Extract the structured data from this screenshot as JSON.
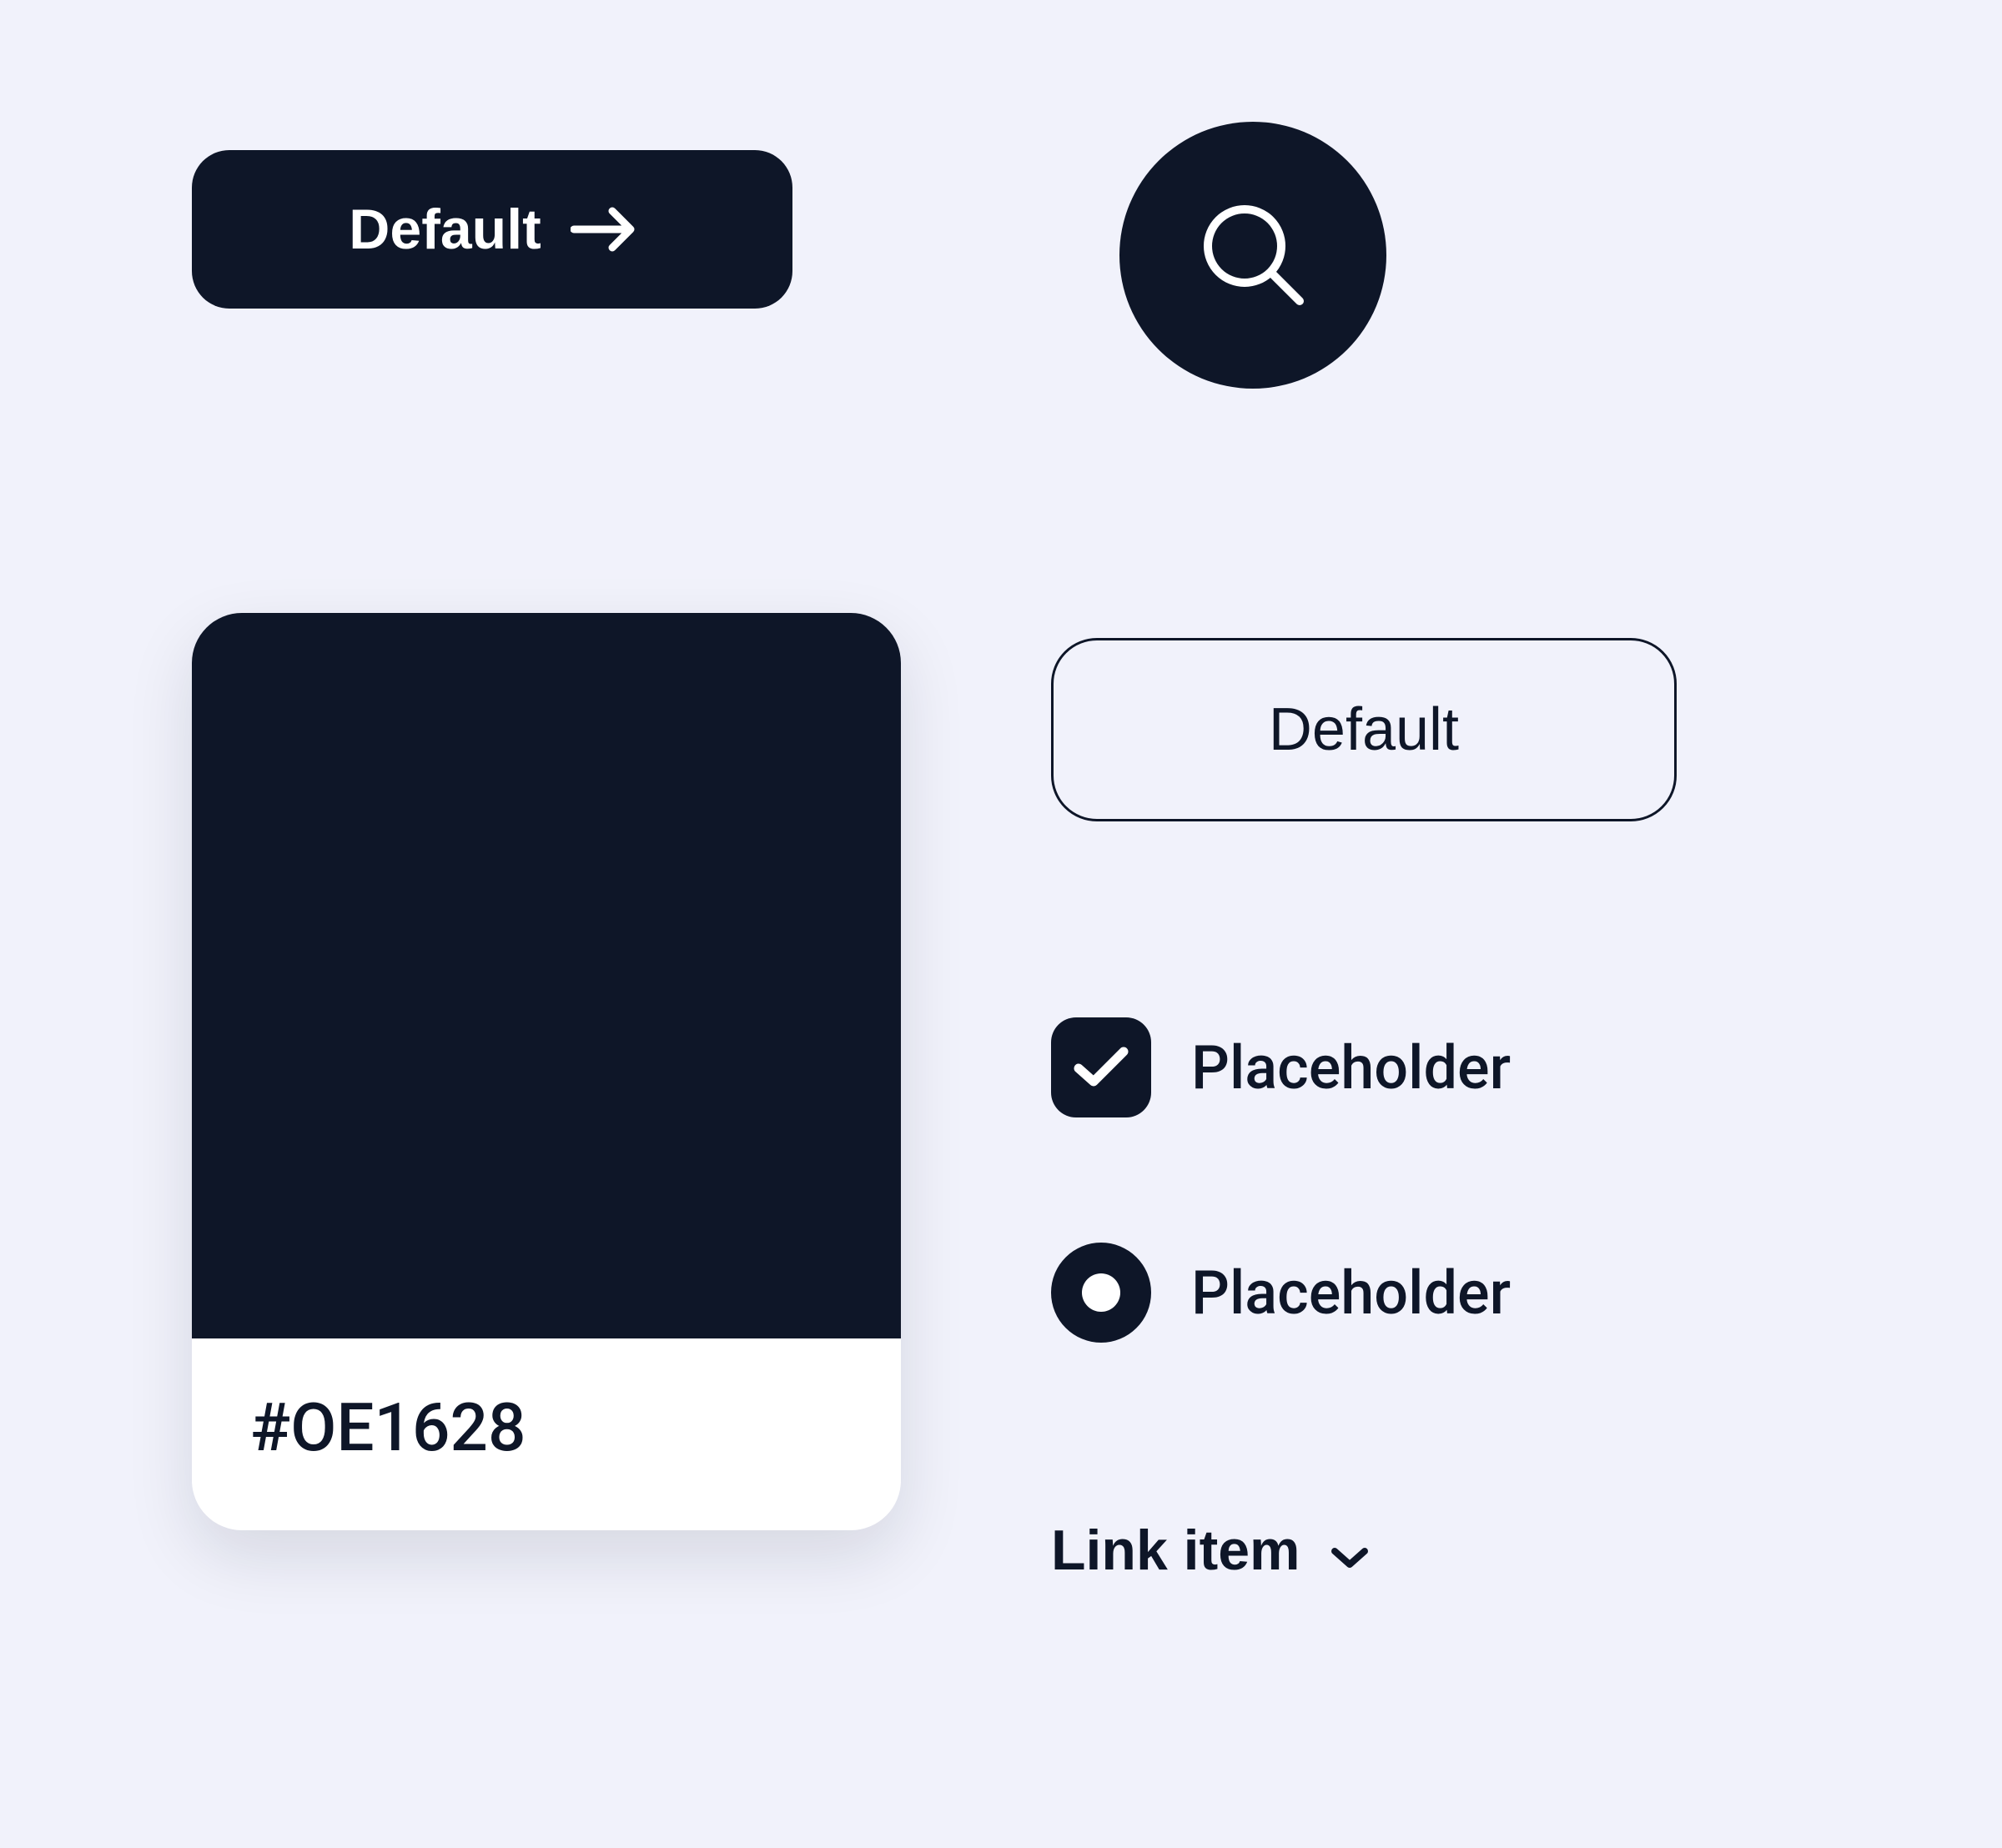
{
  "colors": {
    "primary": "#0E1628",
    "background": "#F1F2FB",
    "white": "#FFFFFF"
  },
  "primaryButton": {
    "label": "Default"
  },
  "outlineButton": {
    "label": "Default"
  },
  "swatch": {
    "hex": "#OE1628"
  },
  "checkbox": {
    "label": "Placeholder",
    "checked": true
  },
  "radio": {
    "label": "Placeholder",
    "selected": true
  },
  "link": {
    "label": "Link item"
  },
  "icons": {
    "arrowRight": "arrow-right-icon",
    "search": "search-icon",
    "check": "check-icon",
    "chevronDown": "chevron-down-icon"
  }
}
